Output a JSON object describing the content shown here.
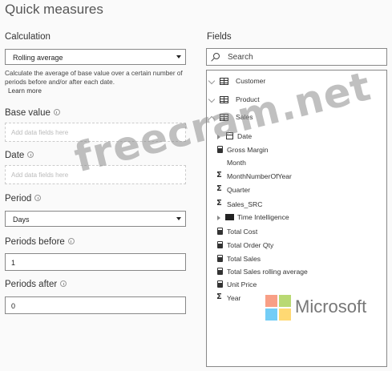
{
  "window": {
    "title": "Quick measures"
  },
  "left": {
    "calculation_label": "Calculation",
    "calculation_value": "Rolling average",
    "description": "Calculate the average of base value over a certain number of periods before and/or after each date.",
    "learn_more": "Learn more",
    "base_value_label": "Base value",
    "base_value_placeholder": "Add data fields here",
    "date_label": "Date",
    "date_placeholder": "Add data fields here",
    "period_label": "Period",
    "period_value": "Days",
    "periods_before_label": "Periods before",
    "periods_before_value": "1",
    "periods_after_label": "Periods after",
    "periods_after_value": "0"
  },
  "fields": {
    "label": "Fields",
    "search_placeholder": "Search",
    "items": [
      {
        "text": "Customer",
        "icon": "table-icon"
      },
      {
        "text": "Product",
        "icon": "table-icon"
      },
      {
        "text": "Sales",
        "icon": "table-icon"
      },
      {
        "text": "Date",
        "icon": "calendar-icon"
      },
      {
        "text": "Gross Margin",
        "icon": "calculator-icon"
      },
      {
        "text": "Month",
        "icon": "none"
      },
      {
        "text": "MonthNumberOfYear",
        "icon": "sigma-icon"
      },
      {
        "text": "Quarter",
        "icon": "sigma-icon"
      },
      {
        "text": "Sales_SRC",
        "icon": "sigma-icon"
      },
      {
        "text": "Time Intelligence",
        "icon": "folder-icon"
      },
      {
        "text": "Total Cost",
        "icon": "calculator-icon"
      },
      {
        "text": "Total Order Qty",
        "icon": "calculator-icon"
      },
      {
        "text": "Total Sales",
        "icon": "calculator-icon"
      },
      {
        "text": "Total Sales rolling average",
        "icon": "calculator-icon"
      },
      {
        "text": "Unit Price",
        "icon": "calculator-icon"
      },
      {
        "text": "Year",
        "icon": "sigma-icon"
      }
    ]
  },
  "overlay": {
    "watermark": "freecram.net",
    "brand": "Microsoft",
    "logo_colors": [
      "#f25022",
      "#7fba00",
      "#00a4ef",
      "#ffb900"
    ]
  }
}
